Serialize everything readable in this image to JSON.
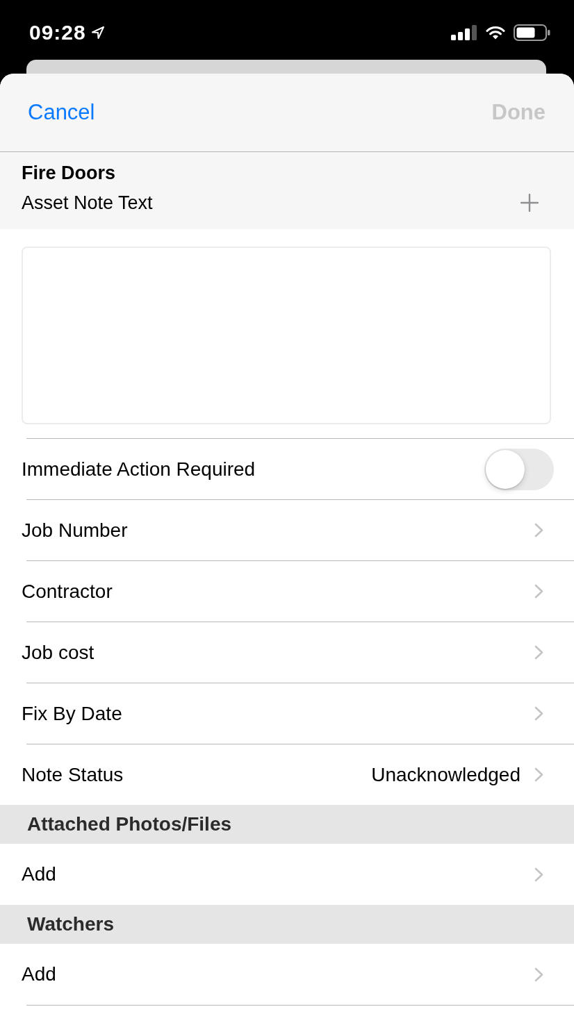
{
  "status_bar": {
    "time": "09:28"
  },
  "nav_bar": {
    "cancel_button": "Cancel",
    "done_button": {
      "label": "Done",
      "disabled": true
    }
  },
  "header": {
    "title": "Fire Doors",
    "subtitle": "Asset Note Text"
  },
  "rows": [
    {
      "kind": "toggle",
      "label": "Immediate Action Required",
      "on": false
    },
    {
      "kind": "disclosure",
      "label": "Job Number"
    },
    {
      "kind": "disclosure",
      "label": "Contractor"
    },
    {
      "kind": "disclosure",
      "label": "Job cost"
    },
    {
      "kind": "disclosure",
      "label": "Fix By Date"
    },
    {
      "kind": "disclosure",
      "label": "Note Status",
      "value": "Unacknowledged"
    }
  ],
  "sections": [
    {
      "title": "Attached Photos/Files",
      "rows": [
        {
          "label": "Add"
        }
      ]
    },
    {
      "title": "Watchers",
      "rows": [
        {
          "label": "Add"
        }
      ]
    }
  ]
}
